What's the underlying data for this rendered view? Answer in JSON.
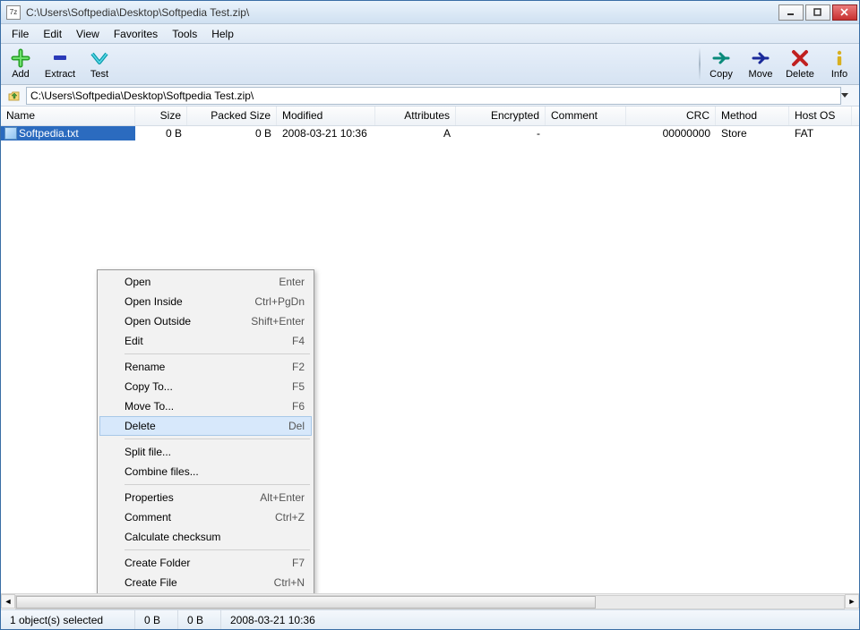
{
  "window": {
    "title": "C:\\Users\\Softpedia\\Desktop\\Softpedia Test.zip\\",
    "app_icon_text": "7z"
  },
  "menubar": [
    "File",
    "Edit",
    "View",
    "Favorites",
    "Tools",
    "Help"
  ],
  "toolbar_left": [
    {
      "label": "Add"
    },
    {
      "label": "Extract"
    },
    {
      "label": "Test"
    }
  ],
  "toolbar_right": [
    {
      "label": "Copy"
    },
    {
      "label": "Move"
    },
    {
      "label": "Delete"
    },
    {
      "label": "Info"
    }
  ],
  "addressbar": {
    "path": "C:\\Users\\Softpedia\\Desktop\\Softpedia Test.zip\\"
  },
  "columns": [
    {
      "label": "Name",
      "width": 150,
      "align": "left"
    },
    {
      "label": "Size",
      "width": 58,
      "align": "right"
    },
    {
      "label": "Packed Size",
      "width": 100,
      "align": "right"
    },
    {
      "label": "Modified",
      "width": 110,
      "align": "left"
    },
    {
      "label": "Attributes",
      "width": 90,
      "align": "right"
    },
    {
      "label": "Encrypted",
      "width": 100,
      "align": "right"
    },
    {
      "label": "Comment",
      "width": 90,
      "align": "left"
    },
    {
      "label": "CRC",
      "width": 100,
      "align": "right"
    },
    {
      "label": "Method",
      "width": 82,
      "align": "left"
    },
    {
      "label": "Host OS",
      "width": 70,
      "align": "left"
    }
  ],
  "files": [
    {
      "name": "Softpedia.txt",
      "size": "0 B",
      "packed_size": "0 B",
      "modified": "2008-03-21 10:36",
      "attributes": "A",
      "encrypted": "-",
      "comment": "",
      "crc": "00000000",
      "method": "Store",
      "host_os": "FAT"
    }
  ],
  "context_menu": [
    {
      "label": "Open",
      "shortcut": "Enter"
    },
    {
      "label": "Open Inside",
      "shortcut": "Ctrl+PgDn"
    },
    {
      "label": "Open Outside",
      "shortcut": "Shift+Enter"
    },
    {
      "label": "Edit",
      "shortcut": "F4"
    },
    {
      "sep": true
    },
    {
      "label": "Rename",
      "shortcut": "F2"
    },
    {
      "label": "Copy To...",
      "shortcut": "F5"
    },
    {
      "label": "Move To...",
      "shortcut": "F6"
    },
    {
      "label": "Delete",
      "shortcut": "Del",
      "hover": true
    },
    {
      "sep": true
    },
    {
      "label": "Split file..."
    },
    {
      "label": "Combine files..."
    },
    {
      "sep": true
    },
    {
      "label": "Properties",
      "shortcut": "Alt+Enter"
    },
    {
      "label": "Comment",
      "shortcut": "Ctrl+Z"
    },
    {
      "label": "Calculate checksum"
    },
    {
      "sep": true
    },
    {
      "label": "Create Folder",
      "shortcut": "F7"
    },
    {
      "label": "Create File",
      "shortcut": "Ctrl+N"
    }
  ],
  "statusbar": {
    "selected": "1 object(s) selected",
    "size1": "0 B",
    "size2": "0 B",
    "date": "2008-03-21 10:36"
  }
}
